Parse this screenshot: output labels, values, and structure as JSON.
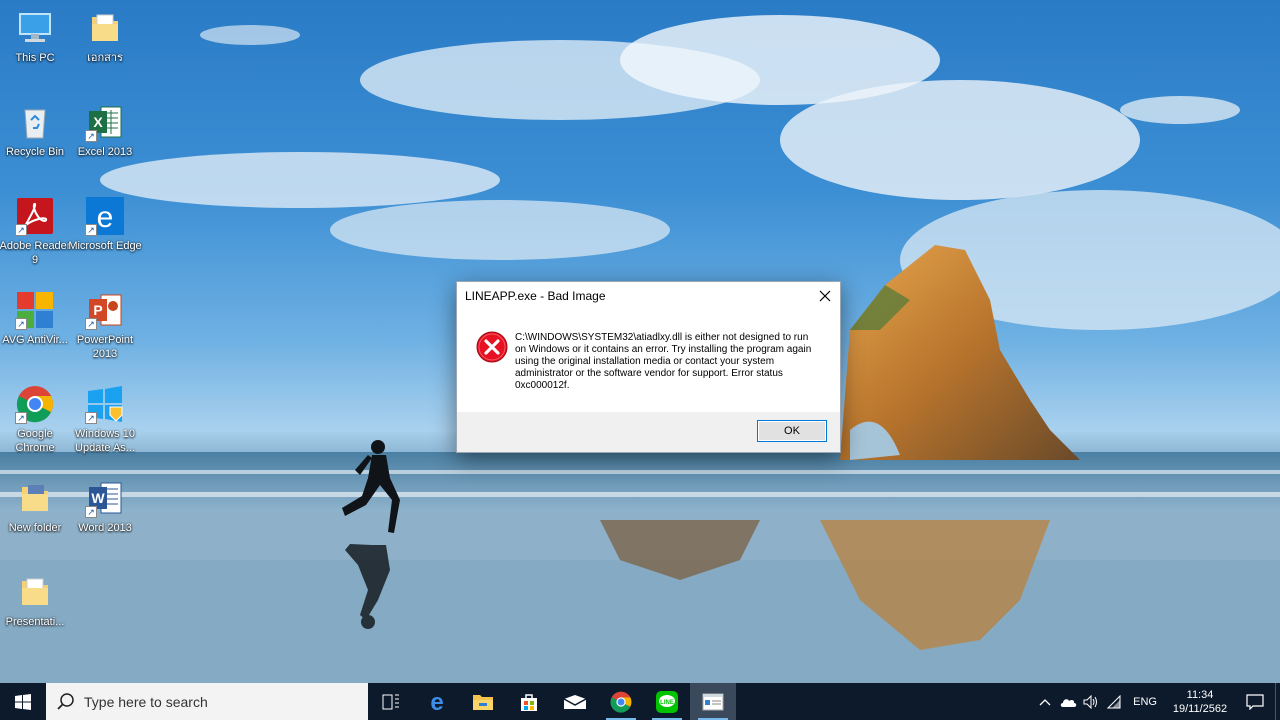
{
  "desktop": {
    "icons": [
      {
        "label": "This PC",
        "icon": "this-pc-icon"
      },
      {
        "label": "เอกสาร",
        "icon": "folder-icon"
      },
      {
        "label": "Recycle Bin",
        "icon": "recycle-bin-icon"
      },
      {
        "label": "Excel 2013",
        "icon": "excel-icon"
      },
      {
        "label": "Adobe Reader 9",
        "icon": "adobe-reader-icon"
      },
      {
        "label": "Microsoft Edge",
        "icon": "edge-icon"
      },
      {
        "label": "AVG AntiVir...",
        "icon": "avg-icon"
      },
      {
        "label": "PowerPoint 2013",
        "icon": "powerpoint-icon"
      },
      {
        "label": "Google Chrome",
        "icon": "chrome-icon"
      },
      {
        "label": "Windows 10 Update As...",
        "icon": "windows-update-icon"
      },
      {
        "label": "New folder",
        "icon": "folder-icon"
      },
      {
        "label": "Word 2013",
        "icon": "word-icon"
      },
      {
        "label": "Presentati...",
        "icon": "folder-icon"
      }
    ]
  },
  "dialog": {
    "title": "LINEAPP.exe - Bad Image",
    "message": "C:\\WINDOWS\\SYSTEM32\\atiadlxy.dll is either not designed to run on Windows or it contains an error. Try installing the program again using the original installation media or contact your system administrator or the software vendor for support. Error status 0xc000012f.",
    "ok_label": "OK",
    "icon": "error-icon"
  },
  "taskbar": {
    "search_placeholder": "Type here to search",
    "apps": [
      "task-view-icon",
      "edge-icon",
      "file-explorer-icon",
      "store-icon",
      "mail-icon",
      "chrome-icon",
      "line-icon",
      "error-window-icon"
    ],
    "language": "ENG",
    "time": "11:34",
    "date": "19/11/2562"
  },
  "colors": {
    "accent": "#0078d7",
    "error_red": "#e81123",
    "taskbar": "#0d1a2b"
  }
}
